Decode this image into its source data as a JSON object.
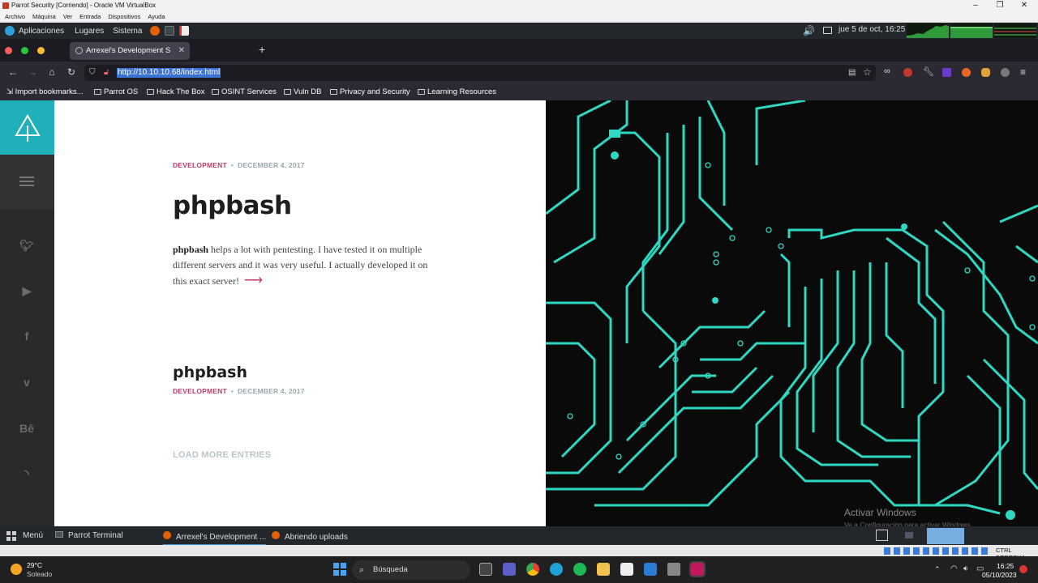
{
  "vbox": {
    "title": "Parrot Security [Corriendo] - Oracle VM VirtualBox",
    "menu": [
      "Archivo",
      "Máquina",
      "Ver",
      "Entrada",
      "Dispositivos",
      "Ayuda"
    ]
  },
  "parrot_panel": {
    "items": [
      "Aplicaciones",
      "Lugares",
      "Sistema"
    ],
    "clock": "jue  5 de oct, 16:25"
  },
  "browser": {
    "tab_title": "Arrexel's Development S",
    "url": "http://10.10.10.68/index.html",
    "bookmarks": [
      "Import bookmarks...",
      "Parrot OS",
      "Hack The Box",
      "OSINT Services",
      "Vuln DB",
      "Privacy and Security",
      "Learning Resources"
    ]
  },
  "page": {
    "post1": {
      "category": "DEVELOPMENT",
      "date": "DECEMBER 4, 2017",
      "title": "phpbash",
      "excerpt_bold": "phpbash",
      "excerpt_rest": " helps a lot with pentesting. I have tested it on multiple different servers and it was very useful. I actually developed it on this exact server!"
    },
    "post2": {
      "title": "phpbash",
      "category": "DEVELOPMENT",
      "date": "DECEMBER 4, 2017"
    },
    "load_more": "LOAD MORE ENTRIES",
    "social": [
      "twitter-icon",
      "youtube-icon",
      "facebook-icon",
      "vimeo-icon",
      "behance-icon",
      "rss-icon"
    ]
  },
  "watermark": {
    "line1": "Activar Windows",
    "line2": "Ve a Configuración para activar Windows."
  },
  "parrot_taskbar": {
    "menu": "Menú",
    "items": [
      "Parrot Terminal",
      "Arrexel's Development ...",
      "Abriendo uploads"
    ]
  },
  "vbox_status": {
    "host_key": "CTRL DERECHA"
  },
  "windows": {
    "weather_temp": "29°C",
    "weather_desc": "Soleado",
    "search_label": "Búsqueda",
    "time": "16:25",
    "date": "05/10/2023"
  },
  "colors": {
    "accent": "#1fb0b9",
    "category": "#c13c6b",
    "circuit": "#2fd8c3"
  }
}
